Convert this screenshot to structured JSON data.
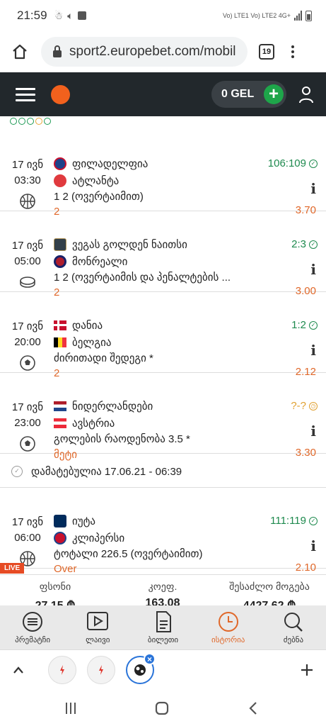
{
  "status_bar": {
    "time": "21:59",
    "network": "Vo) LTE1 Vo) LTE2 4G+"
  },
  "browser": {
    "url": "sport2.europebet.com/mobil",
    "tab_count": "19"
  },
  "header": {
    "balance": "0 GEL"
  },
  "events": [
    {
      "date": "17 ივნ",
      "time": "03:30",
      "sport": "basketball",
      "team1": "ფილადელფია",
      "team2": "ატლანტა",
      "market": "1 2 (ოვერტაიმით)",
      "pick": "2",
      "score": "106:109",
      "score_state": "won",
      "odds": "3.70"
    },
    {
      "date": "17 ივნ",
      "time": "05:00",
      "sport": "hockey",
      "team1": "ვეგას გოლდენ ნაითსი",
      "team2": "მონრეალი",
      "market": "1 2 (ოვერტაიმის და პენალტების ...",
      "pick": "2",
      "score": "2:3",
      "score_state": "won",
      "odds": "3.00"
    },
    {
      "date": "17 ივნ",
      "time": "20:00",
      "sport": "football",
      "team1": "დანია",
      "team2": "ბელგია",
      "market": "ძირითადი შედეგი *",
      "pick": "2",
      "score": "1:2",
      "score_state": "won",
      "odds": "2.12"
    },
    {
      "date": "17 ივნ",
      "time": "23:00",
      "sport": "football",
      "team1": "ნიდერლანდები",
      "team2": "ავსტრია",
      "market": "გოლების რაოდენობა 3.5 *",
      "pick": "მეტი",
      "score": "?-?",
      "score_state": "pending",
      "odds": "3.30"
    },
    {
      "date": "17 ივნ",
      "time": "06:00",
      "sport": "basketball",
      "team1": "იუტა",
      "team2": "კლიპერსი",
      "market": "ტოტალი 226.5 (ოვერტაიმით)",
      "pick": "Over",
      "score": "111:119",
      "score_state": "won",
      "odds": "2.10"
    }
  ],
  "added_row": {
    "text": "დამატებულია 17.06.21 - 06:39"
  },
  "live_badge": "LIVE",
  "summary": {
    "stake_label": "ფსონი",
    "stake_value": "27.15 ₾",
    "coef_label": "კოეფ.",
    "coef_value": "163.08",
    "win_label": "შესაძლო მოგება",
    "win_value": "4427.62 ₾"
  },
  "bottom_nav": [
    {
      "label": "პრემატჩი",
      "icon": "list-icon"
    },
    {
      "label": "ლაივი",
      "icon": "play-icon"
    },
    {
      "label": "ბილეთი",
      "icon": "ticket-icon"
    },
    {
      "label": "ისტორია",
      "icon": "clock-icon",
      "active": true
    },
    {
      "label": "ძებნა",
      "icon": "search-icon"
    }
  ],
  "colors": {
    "accent": "#e0682a",
    "header_bg": "#22282c",
    "won": "#1e8a4e",
    "pending": "#e0a030",
    "live": "#e64b24"
  }
}
